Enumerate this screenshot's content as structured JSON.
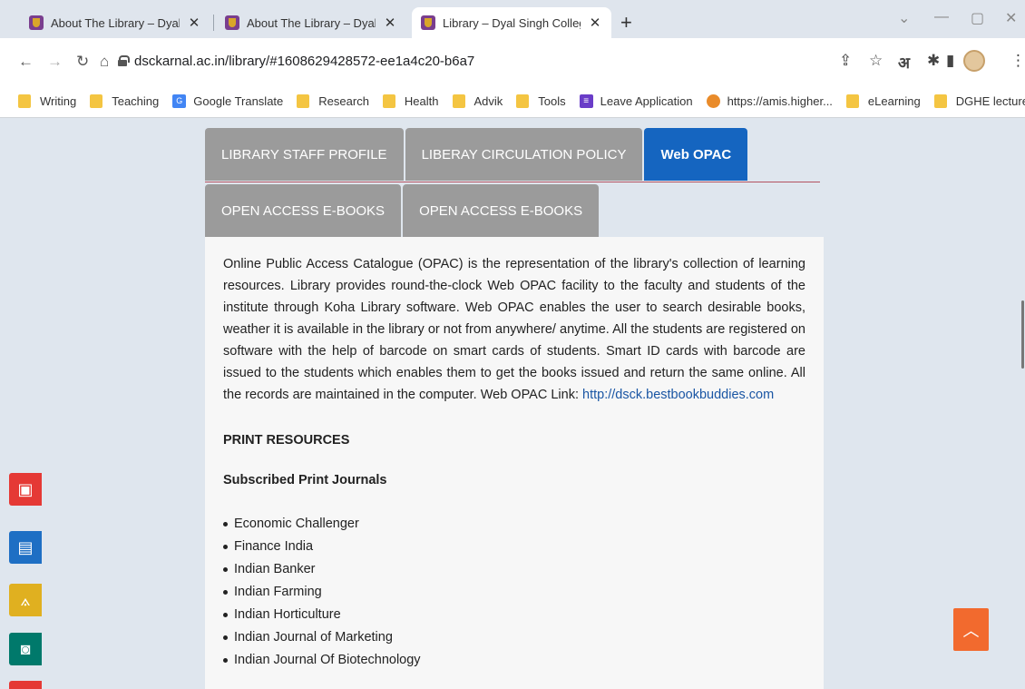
{
  "browser": {
    "tabs": [
      {
        "title": "About The Library – Dyal Singh C",
        "close": "✕"
      },
      {
        "title": "About The Library – Dyal Singh C",
        "close": "✕"
      },
      {
        "title": "Library – Dyal Singh College",
        "close": "✕"
      }
    ],
    "new_tab": "+",
    "url": "dsckarnal.ac.in/library/#1608629428572-ee1a4c20-b6a7",
    "bookmarks": [
      {
        "label": "Writing",
        "icon": "folder-icon"
      },
      {
        "label": "Teaching",
        "icon": "folder-icon"
      },
      {
        "label": "Google Translate",
        "icon": "google-translate-icon"
      },
      {
        "label": "Research",
        "icon": "folder-icon"
      },
      {
        "label": "Health",
        "icon": "folder-icon"
      },
      {
        "label": "Advik",
        "icon": "folder-icon"
      },
      {
        "label": "Tools",
        "icon": "folder-icon"
      },
      {
        "label": "Leave Application",
        "icon": "form-icon"
      },
      {
        "label": "https://amis.higher...",
        "icon": "amis-icon"
      },
      {
        "label": "eLearning",
        "icon": "folder-icon"
      },
      {
        "label": "DGHE lectures",
        "icon": "folder-icon"
      }
    ],
    "extension_letter": "अ"
  },
  "page": {
    "tabs_row1": [
      "LIBRARY STAFF PROFILE",
      "LIBERAY CIRCULATION POLICY",
      "Web OPAC"
    ],
    "tabs_row2": [
      "OPEN ACCESS E-BOOKS",
      "OPEN ACCESS E-BOOKS"
    ],
    "active_tab": "Web OPAC",
    "paragraph": "Online Public Access Catalogue (OPAC) is the representation of the library's collection of learning resources. Library provides round-the-clock Web OPAC facility to the faculty and students of the institute through Koha Library software. Web OPAC enables the user to search desirable books, weather it is available in the library or not from anywhere/ anytime. All the students are registered on software with the help of barcode on smart cards of students. Smart ID cards with barcode are issued to the students which enables them to get the books issued and return the same online.  All the records are maintained in the computer.",
    "opac_link_label": "Web OPAC Link:",
    "opac_link": "http://dsck.bestbookbuddies.com",
    "print_resources": "PRINT RESOURCES",
    "subscribed_heading": "Subscribed Print Journals",
    "journals": [
      "Economic Challenger",
      "Finance India",
      "Indian Banker",
      "Indian Farming",
      "Indian Horticulture",
      "Indian Journal of Marketing",
      "Indian Journal Of Biotechnology"
    ]
  },
  "colors": {
    "active_tab": "#1565c0",
    "inactive_tab": "#9b9b9b",
    "side_red": "#e53935",
    "side_blue": "#1e6fc4",
    "side_yellow": "#e0b020",
    "side_teal": "#00796b",
    "to_top": "#f26a2e"
  }
}
